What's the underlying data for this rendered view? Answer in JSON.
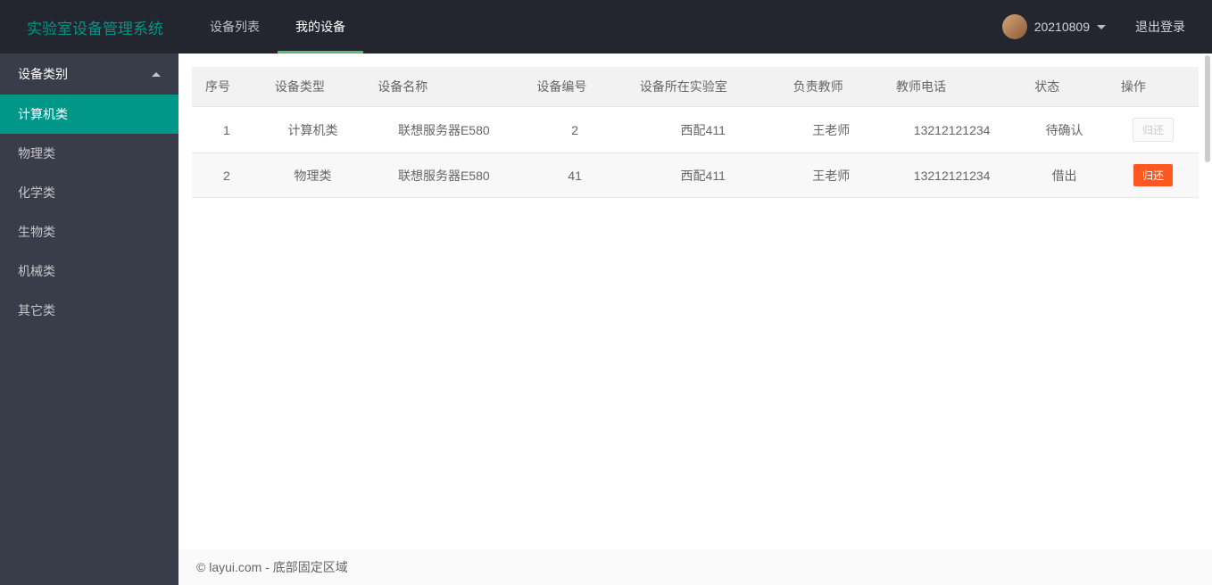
{
  "header": {
    "logo": "实验室设备管理系统",
    "tabs": [
      {
        "label": "设备列表",
        "active": false
      },
      {
        "label": "我的设备",
        "active": true
      }
    ],
    "user": "20210809",
    "logout": "退出登录"
  },
  "sidebar": {
    "title": "设备类别",
    "items": [
      {
        "label": "计算机类",
        "active": true
      },
      {
        "label": "物理类",
        "active": false
      },
      {
        "label": "化学类",
        "active": false
      },
      {
        "label": "生物类",
        "active": false
      },
      {
        "label": "机械类",
        "active": false
      },
      {
        "label": "其它类",
        "active": false
      }
    ]
  },
  "table": {
    "headers": [
      "序号",
      "设备类型",
      "设备名称",
      "设备编号",
      "设备所在实验室",
      "负责教师",
      "教师电话",
      "状态",
      "操作"
    ],
    "rows": [
      {
        "seq": "1",
        "type": "计算机类",
        "name": "联想服务器E580",
        "code": "2",
        "lab": "西配411",
        "teacher": "王老师",
        "phone": "13212121234",
        "status": "待确认",
        "action": "归还",
        "action_enabled": false
      },
      {
        "seq": "2",
        "type": "物理类",
        "name": "联想服务器E580",
        "code": "41",
        "lab": "西配411",
        "teacher": "王老师",
        "phone": "13212121234",
        "status": "借出",
        "action": "归还",
        "action_enabled": true
      }
    ]
  },
  "footer": "© layui.com - 底部固定区域"
}
